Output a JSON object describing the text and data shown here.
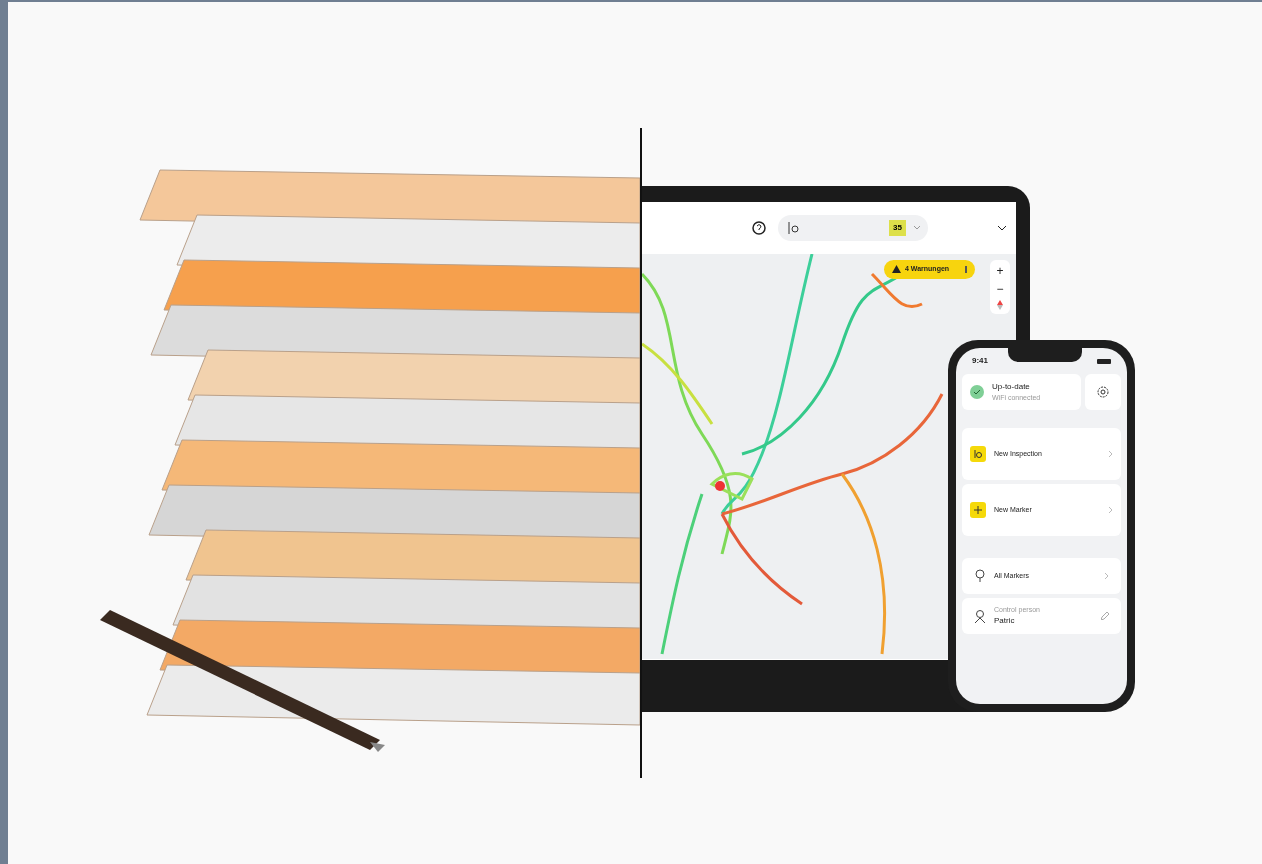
{
  "laptop": {
    "header": {
      "count": "35"
    },
    "map": {
      "warning": "4 Warnungen",
      "zoom_in": "+",
      "zoom_out": "−"
    }
  },
  "phone": {
    "time": "9:41",
    "sync": {
      "title": "Up-to-date",
      "subtitle": "WiFi connected"
    },
    "actions": [
      {
        "label": "New Inspection",
        "kind": "inspect"
      },
      {
        "label": "New Marker",
        "kind": "add"
      }
    ],
    "links": [
      {
        "label": "All Markers",
        "kind": "marker"
      }
    ],
    "person": {
      "caption": "Control person",
      "name": "Patric"
    }
  }
}
